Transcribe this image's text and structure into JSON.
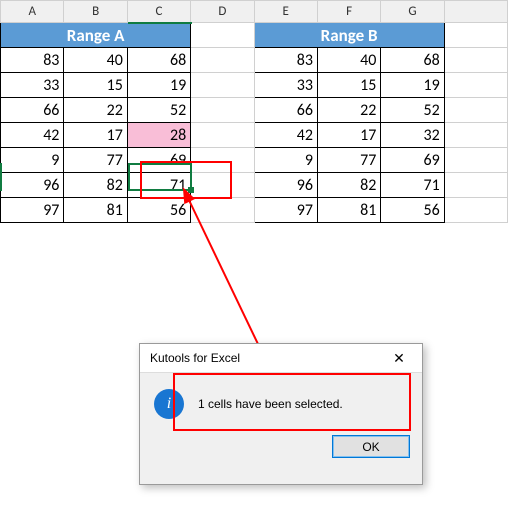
{
  "columns": [
    "A",
    "B",
    "C",
    "D",
    "E",
    "F",
    "G"
  ],
  "rangeA": {
    "title": "Range A"
  },
  "rangeB": {
    "title": "Range B"
  },
  "rows": [
    {
      "a": "83",
      "b": "40",
      "c": "68",
      "e": "83",
      "f": "40",
      "g": "68"
    },
    {
      "a": "33",
      "b": "15",
      "c": "19",
      "e": "33",
      "f": "15",
      "g": "19"
    },
    {
      "a": "66",
      "b": "22",
      "c": "52",
      "e": "66",
      "f": "22",
      "g": "52"
    },
    {
      "a": "42",
      "b": "17",
      "c": "28",
      "e": "42",
      "f": "17",
      "g": "32"
    },
    {
      "a": "9",
      "b": "77",
      "c": "69",
      "e": "9",
      "f": "77",
      "g": "69"
    },
    {
      "a": "96",
      "b": "82",
      "c": "71",
      "e": "96",
      "f": "82",
      "g": "71"
    },
    {
      "a": "97",
      "b": "81",
      "c": "56",
      "e": "97",
      "f": "81",
      "g": "56"
    }
  ],
  "dialog": {
    "title": "Kutools for Excel",
    "message": "1 cells have been selected.",
    "ok": "OK",
    "info_glyph": "i",
    "close_glyph": "✕"
  }
}
